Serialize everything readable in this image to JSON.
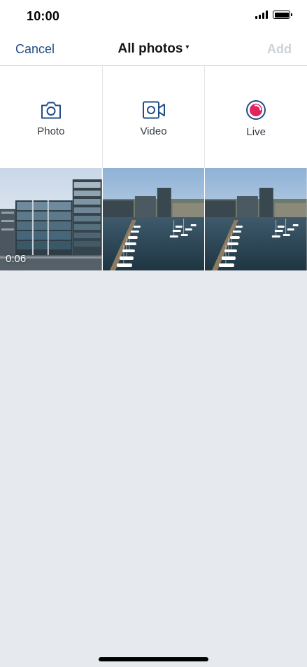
{
  "status_bar": {
    "time": "10:00"
  },
  "nav": {
    "cancel_label": "Cancel",
    "title": "All photos",
    "title_caret": "▾",
    "add_label": "Add"
  },
  "capture_options": [
    {
      "label": "Photo",
      "icon": "camera-icon"
    },
    {
      "label": "Video",
      "icon": "video-camera-icon"
    },
    {
      "label": "Live",
      "icon": "live-broadcast-icon"
    }
  ],
  "media": [
    {
      "kind": "video",
      "duration": "0:06",
      "subject": "office-buildings-waterfront"
    },
    {
      "kind": "photo",
      "subject": "marina-harbor"
    },
    {
      "kind": "photo",
      "subject": "marina-harbor"
    }
  ],
  "colors": {
    "accent": "#1f4e87",
    "disabled": "#cdd2d6",
    "live": "#e0245e",
    "background": "#e6eaee"
  }
}
